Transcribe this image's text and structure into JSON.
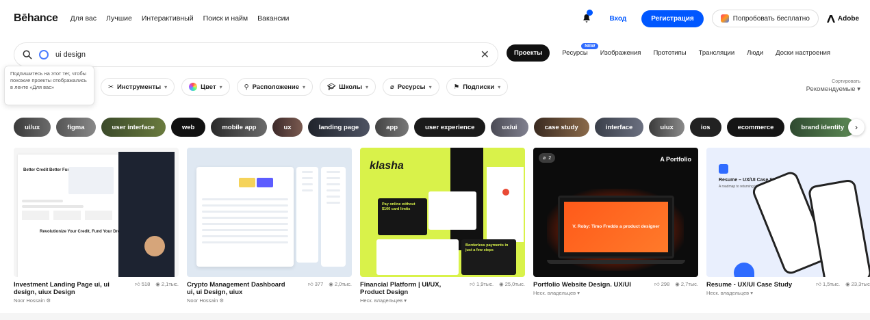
{
  "header": {
    "logo": "Bēhance",
    "nav": [
      "Для вас",
      "Лучшие",
      "Интерактивный",
      "Поиск и найм",
      "Вакансии"
    ],
    "login": "Вход",
    "register": "Регистрация",
    "try_free": "Попробовать бесплатно",
    "adobe": "Adobe"
  },
  "search": {
    "value": "ui design"
  },
  "scopes": {
    "active": "Проекты",
    "items": [
      "Ресурсы",
      "Изображения",
      "Прототипы",
      "Трансляции",
      "Люди",
      "Доски настроения"
    ],
    "new_badge": "NEW"
  },
  "tooltip": {
    "text": "Подпишитесь на этот тег, чтобы похожие проекты отображались в ленте «Для вас»"
  },
  "filters": {
    "tools": "Инструменты",
    "color": "Цвет",
    "location": "Расположение",
    "schools": "Школы",
    "resources": "Ресурсы",
    "subscriptions": "Подписки"
  },
  "sort": {
    "label": "Сортировать",
    "value": "Рекомендуемые"
  },
  "tags": [
    "ui/ux",
    "figma",
    "user interface",
    "web",
    "mobile app",
    "ux",
    "landing page",
    "app",
    "user experience",
    "ux/ui",
    "case study",
    "interface",
    "uiux",
    "ios",
    "ecommerce",
    "brand identity"
  ],
  "cards": [
    {
      "title": "Investment Landing Page ui, ui design, uiux Design",
      "likes": "518",
      "views": "2,1тыс.",
      "owner": "Noor Hossain",
      "thumb": {
        "hero": "Better Credit Better Funding",
        "hero_highlight": "Credit",
        "mid": "Revolutionize Your Credit, Fund Your Dreams"
      }
    },
    {
      "title": "Crypto Management Dashboard ui, ui Design, uiux",
      "likes": "377",
      "views": "2,0тыс.",
      "owner": "Noor Hossain",
      "thumb": {}
    },
    {
      "title": "Financial Platform | UI/UX, Product Design",
      "likes": "1,9тыс.",
      "views": "25,0тыс.",
      "owner": "Неск. владельцев",
      "thumb": {
        "brand": "klasha",
        "panel": "Pay online without $100 card limits",
        "panel2": "Borderless payments in just a few steps"
      }
    },
    {
      "title": "Portfolio Website Design. UX/UI",
      "likes": "298",
      "views": "2,7тыс.",
      "owner": "Неск. владельцев",
      "thumb": {
        "badge": "2",
        "label": "A Portfolio",
        "screen": "V. Roby: Timo Freddo a product designer"
      }
    },
    {
      "title": "Resume - UX/UI Case Study",
      "likes": "1,5тыс.",
      "views": "23,3тыс.",
      "owner": "Неск. владельцев",
      "thumb": {
        "title": "Resume – UX/UI Case Study",
        "subtitle": "A roadmap to returning to work"
      }
    }
  ],
  "colors": {
    "accent": "#0057ff",
    "text": "#191919",
    "muted": "#777777"
  }
}
